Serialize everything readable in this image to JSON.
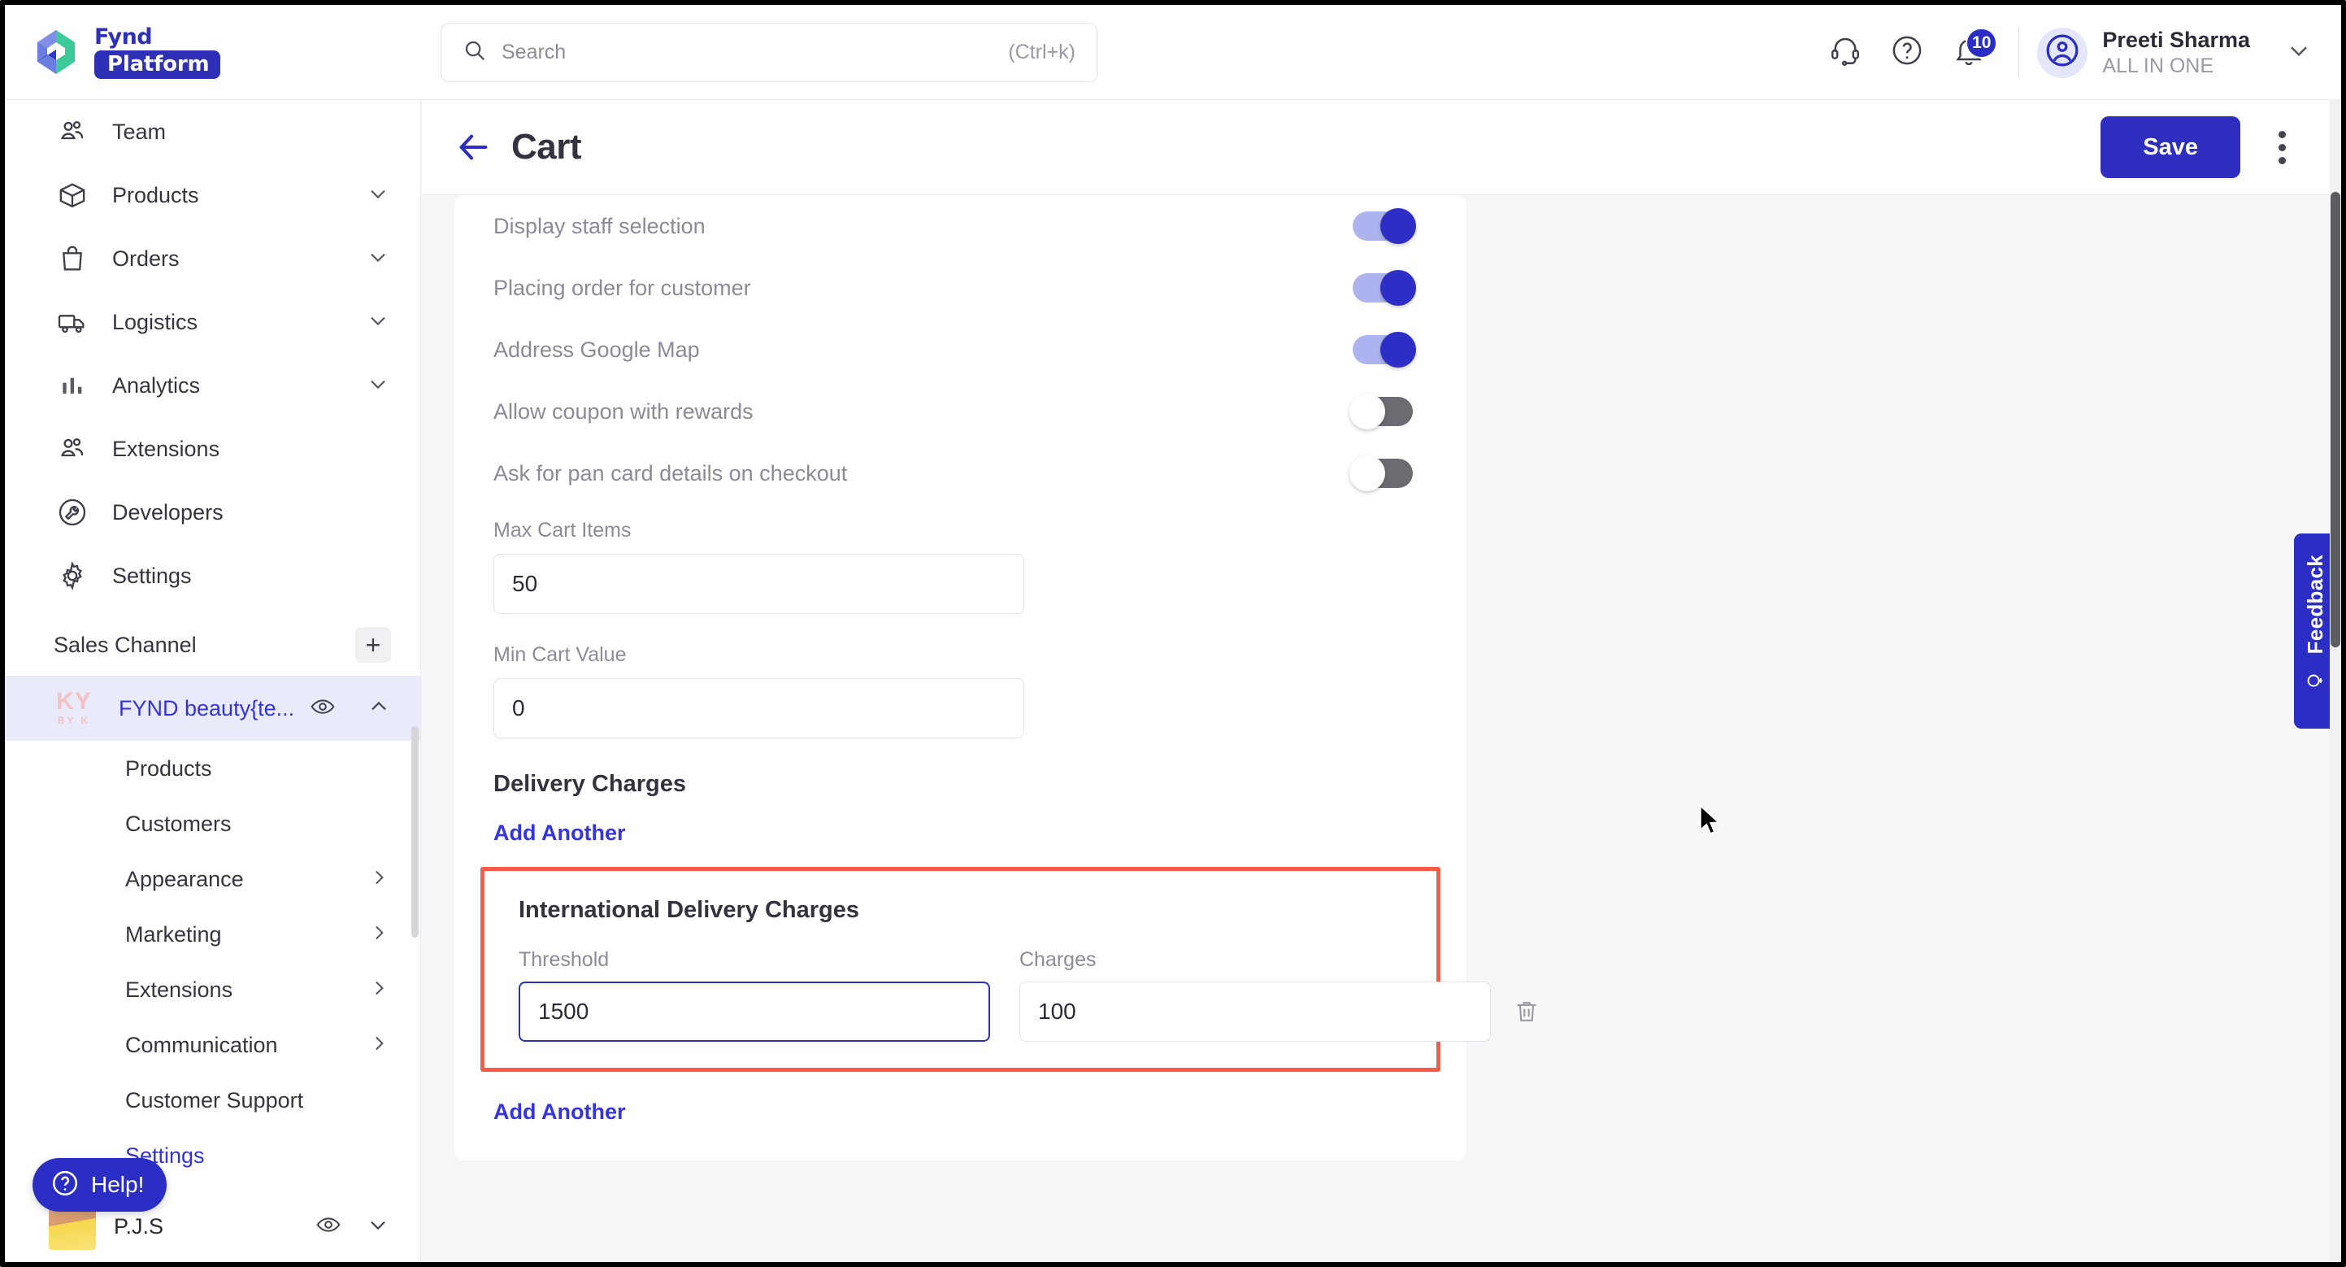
{
  "brand": {
    "line1": "Fynd",
    "line2": "Platform",
    "mark_icon": "fynd-logo-icon"
  },
  "search": {
    "placeholder": "Search",
    "shortcut": "(Ctrl+k)",
    "icon": "search-icon"
  },
  "topbar": {
    "support_icon": "headset-icon",
    "help_icon": "question-circle-icon",
    "notifications_icon": "bell-icon",
    "notifications_count": "10",
    "avatar_icon": "user-circle-icon",
    "user_name": "Preeti Sharma",
    "user_org": "ALL IN ONE",
    "caret_icon": "chevron-down-icon"
  },
  "sidebar": {
    "items": [
      {
        "label": "Team",
        "icon": "people-icon",
        "expandable": false
      },
      {
        "label": "Products",
        "icon": "box-icon",
        "expandable": true
      },
      {
        "label": "Orders",
        "icon": "bag-icon",
        "expandable": true
      },
      {
        "label": "Logistics",
        "icon": "truck-icon",
        "expandable": true
      },
      {
        "label": "Analytics",
        "icon": "bar-chart-icon",
        "expandable": true
      },
      {
        "label": "Extensions",
        "icon": "people-icon",
        "expandable": false
      },
      {
        "label": "Developers",
        "icon": "wrench-circle-icon",
        "expandable": false
      },
      {
        "label": "Settings",
        "icon": "gear-icon",
        "expandable": false
      }
    ],
    "section": {
      "label": "Sales Channel",
      "add_icon": "plus-icon"
    },
    "channel": {
      "logo_top": "KY",
      "logo_bottom": "BY K",
      "name": "FYND beauty{te...",
      "eye_icon": "eye-icon",
      "collapse_icon": "chevron-up-icon"
    },
    "sub_items": [
      {
        "label": "Products",
        "chevron": false,
        "active": false
      },
      {
        "label": "Customers",
        "chevron": false,
        "active": false
      },
      {
        "label": "Appearance",
        "chevron": true,
        "active": false
      },
      {
        "label": "Marketing",
        "chevron": true,
        "active": false
      },
      {
        "label": "Extensions",
        "chevron": true,
        "active": false
      },
      {
        "label": "Communication",
        "chevron": true,
        "active": false
      },
      {
        "label": "Customer Support",
        "chevron": false,
        "active": false
      },
      {
        "label": "Settings",
        "chevron": false,
        "active": true
      }
    ],
    "store": {
      "name": "P.J.S",
      "eye_icon": "eye-icon",
      "caret_icon": "chevron-down-icon",
      "thumb": "store-avatar"
    },
    "help": {
      "label": "Help!",
      "icon": "question-circle-icon"
    }
  },
  "page": {
    "back_icon": "arrow-left-icon",
    "title": "Cart",
    "save_label": "Save",
    "kebab_icon": "more-vertical-icon"
  },
  "cart_settings": {
    "toggles": [
      {
        "label": "Display staff selection",
        "state": "on"
      },
      {
        "label": "Placing order for customer",
        "state": "on"
      },
      {
        "label": "Address Google Map",
        "state": "on"
      },
      {
        "label": "Allow coupon with rewards",
        "state": "off"
      },
      {
        "label": "Ask for pan card details on checkout",
        "state": "off"
      }
    ],
    "max_cart_items": {
      "label": "Max Cart Items",
      "value": "50"
    },
    "min_cart_value": {
      "label": "Min Cart Value",
      "value": "0"
    },
    "delivery_charges": {
      "section_title": "Delivery Charges",
      "add_another_top": "Add Another",
      "add_another_bottom": "Add Another",
      "highlight_color": "#fd5a45",
      "group": {
        "title": "International Delivery Charges",
        "threshold_label": "Threshold",
        "threshold_value": "1500",
        "charges_label": "Charges",
        "charges_value": "100",
        "delete_icon": "trash-icon"
      }
    }
  },
  "feedback": {
    "label": "Feedback",
    "icon": "lightbulb-icon"
  },
  "cursor": {
    "icon": "mouse-pointer-icon"
  },
  "colors": {
    "accent": "#2e2ec0",
    "link": "#3434e0",
    "highlight": "#fd5a45",
    "toggle_on_track": "#adb3ef",
    "toggle_on_knob": "#2d2ec6",
    "toggle_off_track": "#6b6b72",
    "sidebar_active_bg": "#e9eafa",
    "page_bg": "#f7f7f8"
  }
}
